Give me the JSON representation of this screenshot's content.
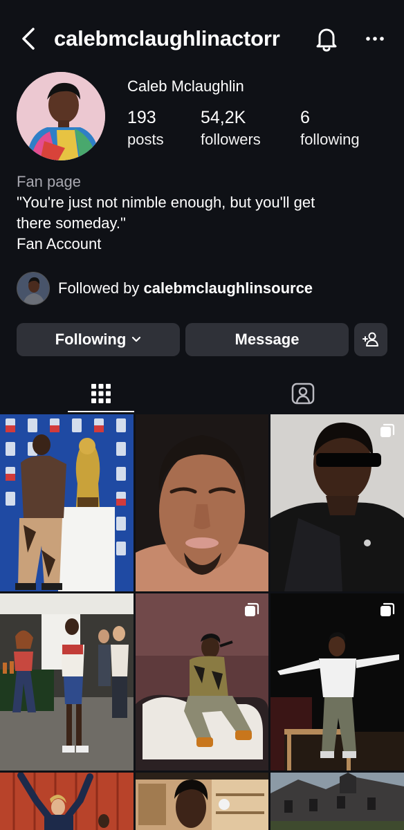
{
  "header": {
    "username": "calebmclaughlinactorr",
    "back_icon": "back-chevron-icon",
    "bell_icon": "bell-icon",
    "more_icon": "more-dots-icon"
  },
  "profile": {
    "display_name": "Caleb Mclaughlin",
    "stats": [
      {
        "value": "193",
        "label": "posts"
      },
      {
        "value": "54,2K",
        "label": "followers"
      },
      {
        "value": "6",
        "label": "following"
      }
    ],
    "category": "Fan page",
    "bio_line1": "\"You're just not nimble enough, but you'll get",
    "bio_line2": "there someday.\"",
    "bio_line3": "Fan Account",
    "followed_by_prefix": "Followed by ",
    "followed_by_user": "calebmclaughlinsource"
  },
  "actions": {
    "following_label": "Following",
    "message_label": "Message",
    "add_person_icon": "add-person-icon"
  },
  "tabs": {
    "grid_icon": "grid-icon",
    "tagged_icon": "tagged-person-icon"
  },
  "colors": {
    "background": "#0f1116",
    "button": "#2f3138",
    "muted_text": "#a8a8b0"
  }
}
